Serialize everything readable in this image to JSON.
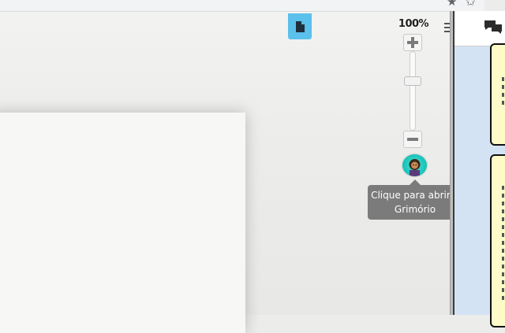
{
  "viewer": {
    "zoom_level": "100%",
    "zoom_slider_fraction": 0.64,
    "tooltip_text": "Clique para abrir o Grimório"
  },
  "icons": {
    "document": "document-icon",
    "zoom_in": "plus-icon",
    "zoom_out": "minus-icon",
    "menu": "menu-icon",
    "chat": "chat-icon",
    "avatar": "grimoire-avatar",
    "bookmark": "star-icon",
    "extensions": "puzzle-icon"
  },
  "colors": {
    "doc_button": "#5bc0eb",
    "right_panel": "#d3e3f4",
    "card": "#fffbc8",
    "tooltip": "#7b7b7b",
    "avatar": "#16c2b8"
  }
}
